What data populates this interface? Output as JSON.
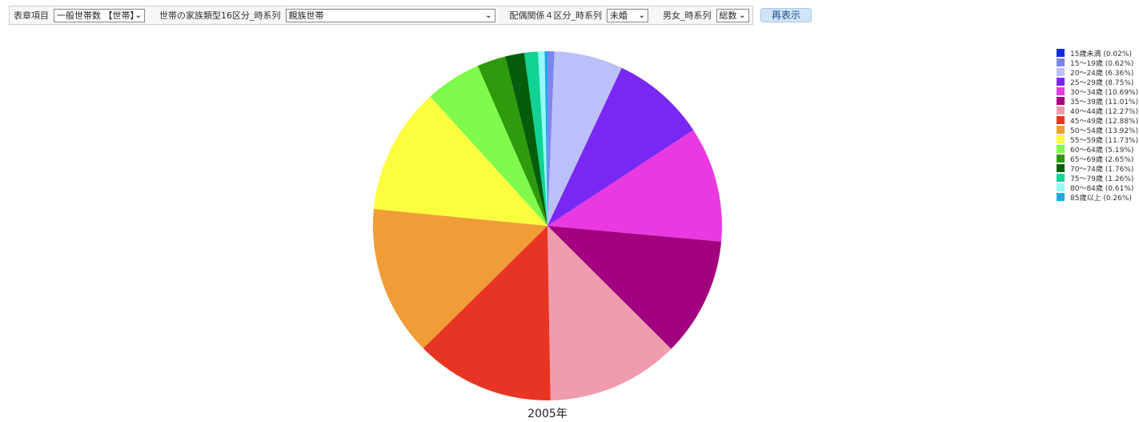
{
  "filters": {
    "item1_label": "表章項目",
    "item1_value": "一般世帯数 【世帯】",
    "item2_label": "世帯の家族類型16区分_時系列",
    "item2_value": "親族世帯",
    "item3_label": "配偶関係４区分_時系列",
    "item3_value": "未婚",
    "item4_label": "男女_時系列",
    "item4_value": "総数",
    "redisplay_label": "再表示"
  },
  "chart_data": {
    "type": "pie",
    "title": "2005年",
    "legend_position": "right",
    "slices": [
      {
        "label": "15歳未満",
        "value": 0.02,
        "legend": "15歳未満 (0.02%)",
        "color": "#0b2be8"
      },
      {
        "label": "15～19歳",
        "value": 0.62,
        "legend": "15～19歳 (0.62%)",
        "color": "#7b86ee"
      },
      {
        "label": "20～24歳",
        "value": 6.36,
        "legend": "20～24歳 (6.36%)",
        "color": "#bbc0fa"
      },
      {
        "label": "25～29歳",
        "value": 8.75,
        "legend": "25～29歳 (8.75%)",
        "color": "#7828f2"
      },
      {
        "label": "30～34歳",
        "value": 10.69,
        "legend": "30～34歳 (10.69%)",
        "color": "#e83ae0"
      },
      {
        "label": "35～39歳",
        "value": 11.01,
        "legend": "35～39歳 (11.01%)",
        "color": "#a3007f"
      },
      {
        "label": "40～44歳",
        "value": 12.27,
        "legend": "40～44歳 (12.27%)",
        "color": "#f19baf"
      },
      {
        "label": "45～49歳",
        "value": 12.88,
        "legend": "45～49歳 (12.88%)",
        "color": "#e83423"
      },
      {
        "label": "50～54歳",
        "value": 13.92,
        "legend": "50～54歳 (13.92%)",
        "color": "#f09d37"
      },
      {
        "label": "55～59歳",
        "value": 11.73,
        "legend": "55～59歳 (11.73%)",
        "color": "#fdfd3f"
      },
      {
        "label": "60～64歳",
        "value": 5.19,
        "legend": "60～64歳 (5.19%)",
        "color": "#80fb4b"
      },
      {
        "label": "65～69歳",
        "value": 2.65,
        "legend": "65～69歳 (2.65%)",
        "color": "#2d9b0b"
      },
      {
        "label": "70～74歳",
        "value": 1.76,
        "legend": "70～74歳 (1.76%)",
        "color": "#045d0a"
      },
      {
        "label": "75～79歳",
        "value": 1.26,
        "legend": "75～79歳 (1.26%)",
        "color": "#10d393"
      },
      {
        "label": "80～84歳",
        "value": 0.61,
        "legend": "80～84歳 (0.61%)",
        "color": "#94fbf7"
      },
      {
        "label": "85歳以上",
        "value": 0.26,
        "legend": "85歳以上 (0.26%)",
        "color": "#1ea8e6"
      }
    ]
  }
}
